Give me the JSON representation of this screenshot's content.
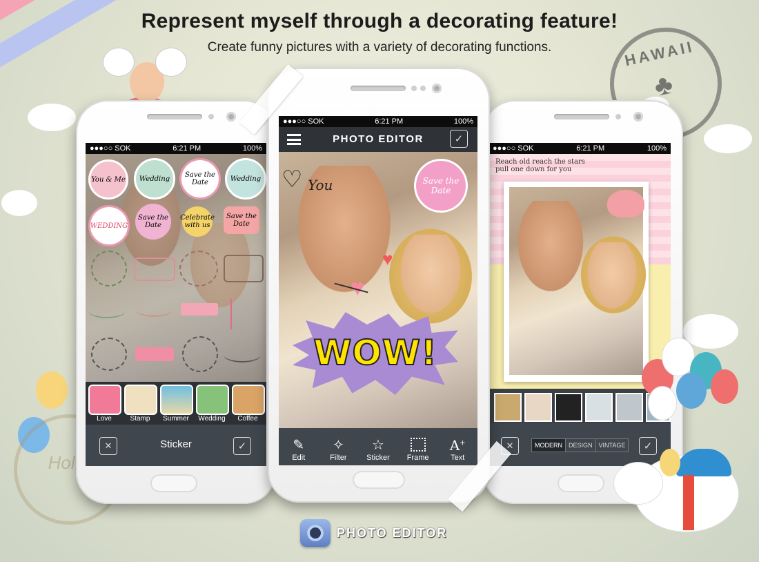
{
  "header": {
    "headline": "Represent myself through a decorating feature!",
    "subline": "Create funny pictures with a variety of decorating functions."
  },
  "status": {
    "carrier": "●●●○○ SOK",
    "time": "6:21 PM",
    "battery": "100%"
  },
  "left_phone": {
    "stickers": [
      {
        "text": "You & Me",
        "color": "#f4c1cc"
      },
      {
        "text": "Wedding",
        "color": "#bfe0d0"
      },
      {
        "text": "Save the Date",
        "color": "#ffffff"
      },
      {
        "text": "Wedding",
        "color": "#c3e3de"
      },
      {
        "text": "WEDDING",
        "color": "#ffffff"
      },
      {
        "text": "Save the Date",
        "color": "#f0b3d2"
      },
      {
        "text": "Celebrate with us",
        "color": "#f4d36a"
      },
      {
        "text": "Save the Date",
        "color": "#f4a6a6"
      }
    ],
    "categories": [
      {
        "label": "Love",
        "icon": "love-category-icon",
        "color": "#f07a98"
      },
      {
        "label": "Stamp",
        "icon": "stamp-category-icon",
        "color": "#efe1bf"
      },
      {
        "label": "Summer",
        "icon": "summer-category-icon",
        "color": "#6fbfe3"
      },
      {
        "label": "Wedding",
        "icon": "wedding-category-icon",
        "color": "#87c27a"
      },
      {
        "label": "Coffee",
        "icon": "coffee-category-icon",
        "color": "#d9a466"
      }
    ],
    "bottom_title": "Sticker"
  },
  "center_phone": {
    "app_title": "PHOTO EDITOR",
    "love_text": "You",
    "wow_text": "WOW!",
    "toolbar": [
      {
        "label": "Edit",
        "icon": "edit-icon"
      },
      {
        "label": "Filter",
        "icon": "filter-wand-icon"
      },
      {
        "label": "Sticker",
        "icon": "star-icon"
      },
      {
        "label": "Frame",
        "icon": "frame-icon"
      },
      {
        "label": "Text",
        "icon": "text-icon"
      }
    ]
  },
  "right_phone": {
    "note_line1": "Reach old reach the stars",
    "note_line2": "pull one down for you",
    "frame_tabs": [
      "MODERN",
      "DESIGN",
      "VINTAGE"
    ],
    "active_tab": "MODERN"
  },
  "brand": {
    "name": "PHOTO EDITOR"
  },
  "decor": {
    "stamp_hawaii": "HAWAII",
    "stamp_left": "Hol..."
  }
}
